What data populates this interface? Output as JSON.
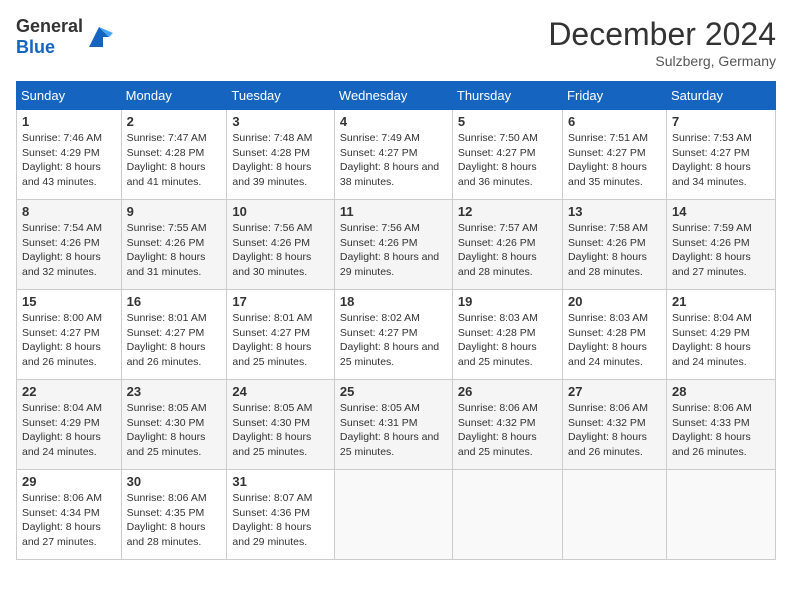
{
  "header": {
    "logo_general": "General",
    "logo_blue": "Blue",
    "month_title": "December 2024",
    "location": "Sulzberg, Germany"
  },
  "days_of_week": [
    "Sunday",
    "Monday",
    "Tuesday",
    "Wednesday",
    "Thursday",
    "Friday",
    "Saturday"
  ],
  "weeks": [
    [
      {
        "day": "1",
        "sunrise": "7:46 AM",
        "sunset": "4:29 PM",
        "daylight": "8 hours and 43 minutes."
      },
      {
        "day": "2",
        "sunrise": "7:47 AM",
        "sunset": "4:28 PM",
        "daylight": "8 hours and 41 minutes."
      },
      {
        "day": "3",
        "sunrise": "7:48 AM",
        "sunset": "4:28 PM",
        "daylight": "8 hours and 39 minutes."
      },
      {
        "day": "4",
        "sunrise": "7:49 AM",
        "sunset": "4:27 PM",
        "daylight": "8 hours and 38 minutes."
      },
      {
        "day": "5",
        "sunrise": "7:50 AM",
        "sunset": "4:27 PM",
        "daylight": "8 hours and 36 minutes."
      },
      {
        "day": "6",
        "sunrise": "7:51 AM",
        "sunset": "4:27 PM",
        "daylight": "8 hours and 35 minutes."
      },
      {
        "day": "7",
        "sunrise": "7:53 AM",
        "sunset": "4:27 PM",
        "daylight": "8 hours and 34 minutes."
      }
    ],
    [
      {
        "day": "8",
        "sunrise": "7:54 AM",
        "sunset": "4:26 PM",
        "daylight": "8 hours and 32 minutes."
      },
      {
        "day": "9",
        "sunrise": "7:55 AM",
        "sunset": "4:26 PM",
        "daylight": "8 hours and 31 minutes."
      },
      {
        "day": "10",
        "sunrise": "7:56 AM",
        "sunset": "4:26 PM",
        "daylight": "8 hours and 30 minutes."
      },
      {
        "day": "11",
        "sunrise": "7:56 AM",
        "sunset": "4:26 PM",
        "daylight": "8 hours and 29 minutes."
      },
      {
        "day": "12",
        "sunrise": "7:57 AM",
        "sunset": "4:26 PM",
        "daylight": "8 hours and 28 minutes."
      },
      {
        "day": "13",
        "sunrise": "7:58 AM",
        "sunset": "4:26 PM",
        "daylight": "8 hours and 28 minutes."
      },
      {
        "day": "14",
        "sunrise": "7:59 AM",
        "sunset": "4:26 PM",
        "daylight": "8 hours and 27 minutes."
      }
    ],
    [
      {
        "day": "15",
        "sunrise": "8:00 AM",
        "sunset": "4:27 PM",
        "daylight": "8 hours and 26 minutes."
      },
      {
        "day": "16",
        "sunrise": "8:01 AM",
        "sunset": "4:27 PM",
        "daylight": "8 hours and 26 minutes."
      },
      {
        "day": "17",
        "sunrise": "8:01 AM",
        "sunset": "4:27 PM",
        "daylight": "8 hours and 25 minutes."
      },
      {
        "day": "18",
        "sunrise": "8:02 AM",
        "sunset": "4:27 PM",
        "daylight": "8 hours and 25 minutes."
      },
      {
        "day": "19",
        "sunrise": "8:03 AM",
        "sunset": "4:28 PM",
        "daylight": "8 hours and 25 minutes."
      },
      {
        "day": "20",
        "sunrise": "8:03 AM",
        "sunset": "4:28 PM",
        "daylight": "8 hours and 24 minutes."
      },
      {
        "day": "21",
        "sunrise": "8:04 AM",
        "sunset": "4:29 PM",
        "daylight": "8 hours and 24 minutes."
      }
    ],
    [
      {
        "day": "22",
        "sunrise": "8:04 AM",
        "sunset": "4:29 PM",
        "daylight": "8 hours and 24 minutes."
      },
      {
        "day": "23",
        "sunrise": "8:05 AM",
        "sunset": "4:30 PM",
        "daylight": "8 hours and 25 minutes."
      },
      {
        "day": "24",
        "sunrise": "8:05 AM",
        "sunset": "4:30 PM",
        "daylight": "8 hours and 25 minutes."
      },
      {
        "day": "25",
        "sunrise": "8:05 AM",
        "sunset": "4:31 PM",
        "daylight": "8 hours and 25 minutes."
      },
      {
        "day": "26",
        "sunrise": "8:06 AM",
        "sunset": "4:32 PM",
        "daylight": "8 hours and 25 minutes."
      },
      {
        "day": "27",
        "sunrise": "8:06 AM",
        "sunset": "4:32 PM",
        "daylight": "8 hours and 26 minutes."
      },
      {
        "day": "28",
        "sunrise": "8:06 AM",
        "sunset": "4:33 PM",
        "daylight": "8 hours and 26 minutes."
      }
    ],
    [
      {
        "day": "29",
        "sunrise": "8:06 AM",
        "sunset": "4:34 PM",
        "daylight": "8 hours and 27 minutes."
      },
      {
        "day": "30",
        "sunrise": "8:06 AM",
        "sunset": "4:35 PM",
        "daylight": "8 hours and 28 minutes."
      },
      {
        "day": "31",
        "sunrise": "8:07 AM",
        "sunset": "4:36 PM",
        "daylight": "8 hours and 29 minutes."
      },
      null,
      null,
      null,
      null
    ]
  ]
}
